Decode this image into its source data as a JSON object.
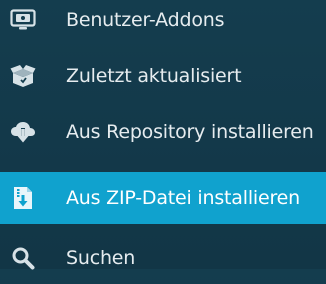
{
  "menu": {
    "items": [
      {
        "label": "Benutzer-Addons",
        "icon": "monitor-icon",
        "selected": false
      },
      {
        "label": "Zuletzt aktualisiert",
        "icon": "open-box-icon",
        "selected": false
      },
      {
        "label": "Aus Repository installieren",
        "icon": "cloud-download-icon",
        "selected": false
      },
      {
        "label": "Aus ZIP-Datei installieren",
        "icon": "zip-file-download-icon",
        "selected": true
      },
      {
        "label": "Suchen",
        "icon": "search-icon",
        "selected": false
      }
    ]
  },
  "colors": {
    "background": "#13394a",
    "selected_background": "#10a2ce",
    "text": "#e6ecef",
    "icon": "#d7e2e7"
  }
}
